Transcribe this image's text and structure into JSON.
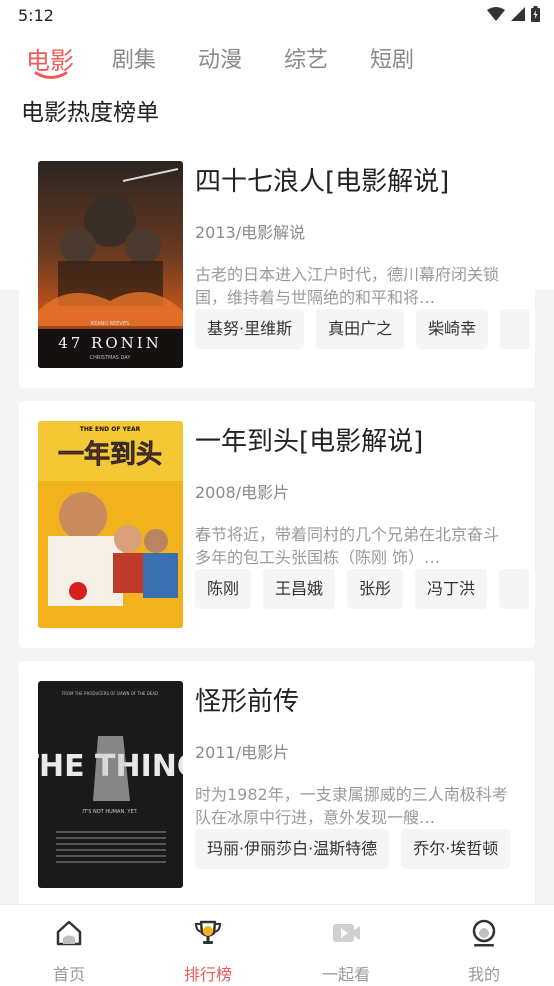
{
  "status_bar": {
    "time": "5:12"
  },
  "tabs": [
    {
      "label": "电影",
      "active": true
    },
    {
      "label": "剧集",
      "active": false
    },
    {
      "label": "动漫",
      "active": false
    },
    {
      "label": "综艺",
      "active": false
    },
    {
      "label": "短剧",
      "active": false
    }
  ],
  "section_title": "电影热度榜单",
  "movies": [
    {
      "title": "四十七浪人[电影解说]",
      "meta": "2013/电影解说",
      "description": "古老的日本进入江户时代，德川幕府闭关锁国，维持着与世隔绝的和平和将…",
      "cast": [
        "基努·里维斯",
        "真田广之",
        "柴崎幸"
      ],
      "poster": {
        "caption": "47 RONIN",
        "top_text": "KEANU REEVES",
        "sub_text": "CHRISTMAS DAY"
      }
    },
    {
      "title": "一年到头[电影解说]",
      "meta": "2008/电影片",
      "description": "春节将近，带着同村的几个兄弟在北京奋斗多年的包工头张国栋（陈刚 饰）…",
      "cast": [
        "陈刚",
        "王昌娥",
        "张彤",
        "冯丁洪"
      ],
      "poster": {
        "caption": "一年到头",
        "top_text": "THE END OF YEAR"
      }
    },
    {
      "title": "怪形前传",
      "meta": "2011/电影片",
      "description": "时为1982年，一支隶属挪威的三人南极科考队在冰原中行进，意外发现一艘…",
      "cast": [
        "玛丽·伊丽莎白·温斯特德",
        "乔尔·埃哲顿"
      ],
      "poster": {
        "caption": "THE THING",
        "top_text": "FROM THE PRODUCERS OF DAWN OF THE DEAD",
        "sub_text": "IT'S NOT HUMAN. YET."
      }
    }
  ],
  "bottom_nav": [
    {
      "label": "首页",
      "icon": "home-icon",
      "active": false
    },
    {
      "label": "排行榜",
      "icon": "trophy-icon",
      "active": true
    },
    {
      "label": "一起看",
      "icon": "video-icon",
      "active": false
    },
    {
      "label": "我的",
      "icon": "profile-icon",
      "active": false
    }
  ],
  "colors": {
    "accent": "#ef5a5a",
    "muted": "#9a9a9a",
    "chip_bg": "#f5f5f5",
    "page_bg": "#f4f4f4"
  }
}
